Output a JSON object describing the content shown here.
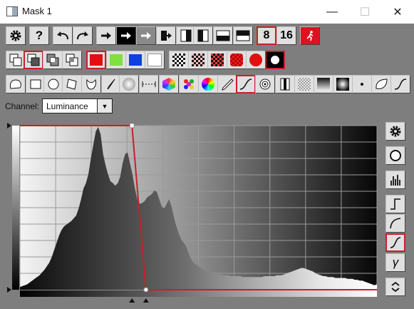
{
  "window": {
    "title": "Mask 1",
    "minimize": "—",
    "maximize": "☐",
    "close": "✕"
  },
  "toolbar1": {
    "depth_8": "8",
    "depth_16": "16",
    "help": "?",
    "buttons": [
      "settings",
      "help",
      "undo",
      "redo",
      "arrow-right",
      "arrow-right-filled",
      "arrow-right-gray",
      "export",
      "split-vertical-left",
      "split-vertical-right",
      "split-horizontal-bottom",
      "split-horizontal-top",
      "depth-8",
      "depth-16",
      "exit"
    ]
  },
  "toolbar2": {
    "buttons": [
      "mask-add",
      "mask-subtract",
      "mask-intersect",
      "mask-exclude",
      "color-red",
      "color-green",
      "color-blue",
      "color-white",
      "checker-1",
      "checker-2",
      "checker-3",
      "checker-4",
      "checker-5",
      "checker-circle"
    ],
    "colors": {
      "red": "#e01010",
      "green": "#7fe040",
      "blue": "#1040e0",
      "white": "#ffffff"
    }
  },
  "toolbar3": {
    "buttons": [
      "lasso",
      "rectangle",
      "ellipse",
      "polygon",
      "freehand",
      "brush",
      "soft-circle",
      "linear-gradient",
      "color-cube",
      "color-dots",
      "color-wheel",
      "eyedropper",
      "tone-curve",
      "spiral",
      "bw-split",
      "checker-fade",
      "vertical-gradient",
      "radial-gradient",
      "dot",
      "leaf",
      "s-curve"
    ]
  },
  "channel": {
    "label": "Channel:",
    "value": "Luminance"
  },
  "side_buttons": [
    "settings",
    "circle",
    "histogram",
    "curve-step",
    "curve-smooth",
    "curve-s",
    "gamma",
    "up-down"
  ],
  "side_labels": {
    "gamma": "γ"
  },
  "curve": {
    "points": [
      [
        0,
        255
      ],
      [
        80,
        255
      ],
      [
        90,
        0
      ],
      [
        255,
        0
      ]
    ]
  },
  "histogram": {
    "levels": [
      3,
      4,
      5,
      6,
      8,
      10,
      12,
      14,
      16,
      19,
      22,
      26,
      30,
      36,
      44,
      52,
      60,
      66,
      70,
      72,
      74,
      76,
      79,
      82,
      90,
      100,
      112,
      118,
      128,
      145,
      160,
      175,
      180,
      172,
      150,
      138,
      128,
      120,
      118,
      115,
      118,
      125,
      140,
      150,
      152,
      140,
      128,
      112,
      100,
      95,
      96,
      98,
      102,
      104,
      106,
      110,
      108,
      100,
      92,
      90,
      95,
      100,
      92,
      80,
      70,
      62,
      55,
      52,
      48,
      40,
      34,
      30,
      28,
      26,
      24,
      22,
      20,
      20,
      19,
      18,
      18,
      17,
      17,
      16,
      16,
      16,
      15,
      15,
      15,
      15,
      15,
      14,
      14,
      14,
      14,
      14,
      14,
      14,
      14,
      14,
      15,
      15,
      15,
      15,
      15,
      16,
      16,
      16,
      17,
      18,
      19,
      20,
      21,
      22,
      23,
      24,
      24,
      23,
      22,
      21,
      20,
      18,
      17,
      16,
      15,
      15,
      14,
      14,
      14,
      13,
      13,
      13,
      13,
      13,
      12,
      12,
      12,
      11,
      11,
      10,
      10,
      9,
      8,
      7,
      6,
      5,
      6
    ]
  }
}
